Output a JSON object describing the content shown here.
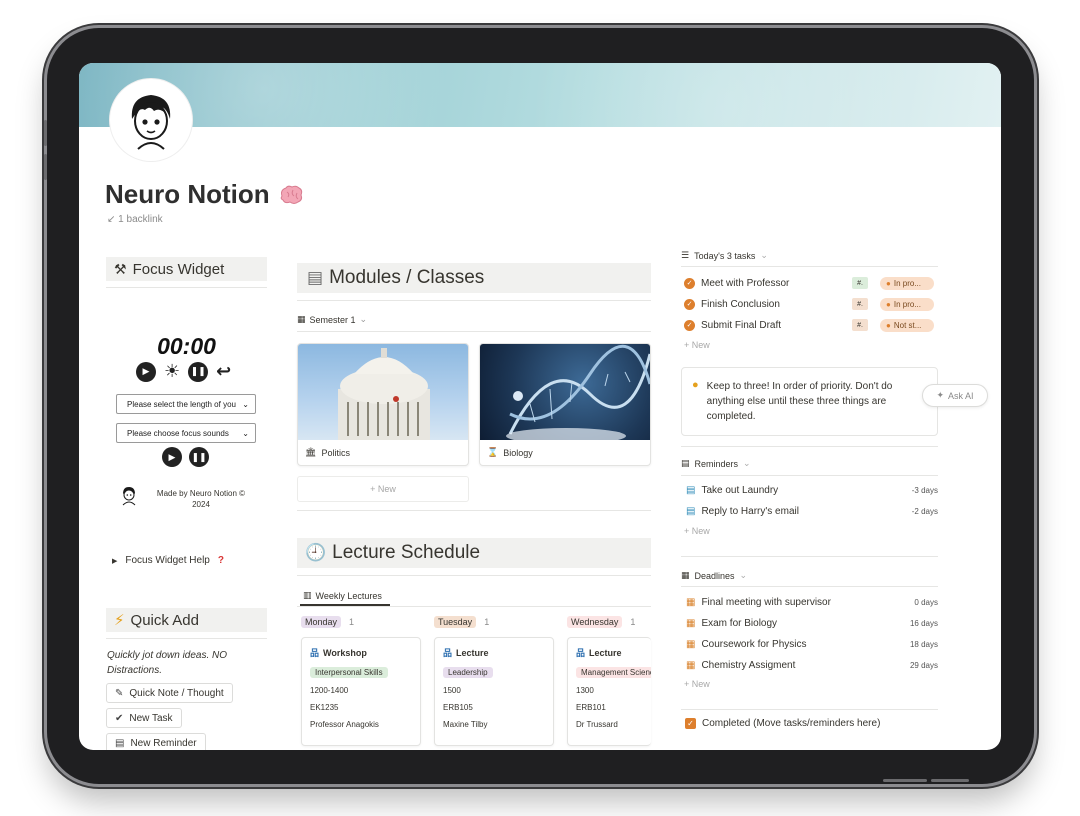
{
  "page": {
    "title": "Neuro Notion",
    "backlinks": "1 backlink"
  },
  "focus_widget": {
    "title": "Focus Widget",
    "timer": "00:00",
    "length_select": "Please select the length of you",
    "sounds_select": "Please choose focus sounds",
    "credit": "Made by Neuro Notion © 2024",
    "help_toggle": "Focus Widget Help"
  },
  "quick_add": {
    "title": "Quick Add",
    "subtitle": "Quickly jot down ideas. NO Distractions.",
    "buttons": [
      "Quick Note / Thought",
      "New Task",
      "New Reminder"
    ]
  },
  "modules": {
    "title": "Modules / Classes",
    "view": "Semester 1",
    "cards": [
      {
        "name": "Politics",
        "icon": "building-columns-icon"
      },
      {
        "name": "Biology",
        "icon": "hourglass-icon"
      }
    ],
    "new_label": "+ New"
  },
  "lecture_schedule": {
    "title": "Lecture Schedule",
    "tab": "Weekly Lectures",
    "days": [
      {
        "day": "Monday",
        "count": "1",
        "color": "#e8deee",
        "type": "Workshop",
        "tag": "Interpersonal Skills",
        "tag_color": "#dbeddb",
        "time": "1200-1400",
        "room": "EK1235",
        "lecturer": "Professor Anagokis"
      },
      {
        "day": "Tuesday",
        "count": "1",
        "color": "#f4dfcf",
        "type": "Lecture",
        "tag": "Leadership",
        "tag_color": "#e8deee",
        "time": "1500",
        "room": "ERB105",
        "lecturer": "Maxine Tilby"
      },
      {
        "day": "Wednesday",
        "count": "1",
        "color": "#fbe4e4",
        "type": "Lecture",
        "tag": "Management Science",
        "tag_color": "#fbe4e4",
        "time": "1300",
        "room": "ERB101",
        "lecturer": "Dr Trussard"
      }
    ]
  },
  "todays_tasks": {
    "title": "Today's 3 tasks",
    "tasks": [
      {
        "name": "Meet with Professor",
        "hash": "#.",
        "hash_color": "#dbeddb",
        "status": "In pro..."
      },
      {
        "name": "Finish Conclusion",
        "hash": "#.",
        "hash_color": "#f4dfcf",
        "status": "In pro..."
      },
      {
        "name": "Submit Final Draft",
        "hash": "#.",
        "hash_color": "#f4dfcf",
        "status": "Not st..."
      }
    ],
    "new_label": "+ New",
    "callout": "Keep to three! In order of priority. Don't do anything else until these three things are completed.",
    "ask_ai": "Ask AI"
  },
  "reminders": {
    "title": "Reminders",
    "items": [
      {
        "name": "Take out Laundry",
        "due": "-3 days"
      },
      {
        "name": "Reply to Harry's email",
        "due": "-2 days"
      }
    ],
    "new_label": "+ New"
  },
  "deadlines": {
    "title": "Deadlines",
    "items": [
      {
        "name": "Final meeting with supervisor",
        "due": "0 days"
      },
      {
        "name": "Exam for Biology",
        "due": "16 days"
      },
      {
        "name": "Coursework for Physics",
        "due": "18 days"
      },
      {
        "name": "Chemistry Assigment",
        "due": "29 days"
      }
    ],
    "new_label": "+ New"
  },
  "completed": {
    "title": "Completed (Move tasks/reminders here)"
  },
  "colors": {
    "accent_orange": "#dd7f2d",
    "reminder_blue": "#2e8bb8",
    "deadline_orange": "#d9822b",
    "section_bg": "#f1f1ef"
  }
}
